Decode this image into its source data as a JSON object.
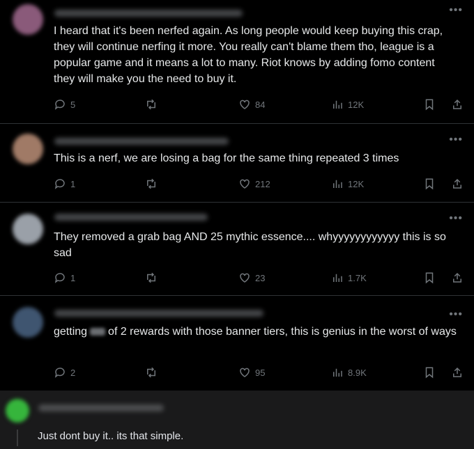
{
  "tweets": [
    {
      "text": "I heard that it's been nerfed again. As long people would keep buying this crap, they will continue nerfing it more. You really can't blame them tho, league is a popular game and it means a lot to many. Riot knows by adding fomo content they will make you the need to buy it.",
      "replies": "5",
      "likes": "84",
      "views": "12K"
    },
    {
      "text": "This is a nerf, we are losing a bag for the same thing repeated 3 times",
      "replies": "1",
      "likes": "212",
      "views": "12K"
    },
    {
      "text": "They removed a grab bag AND 25 mythic essence.... whyyyyyyyyyyyy this is so sad",
      "replies": "1",
      "likes": "23",
      "views": "1.7K"
    },
    {
      "text_before": "getting",
      "text_after": "of 2 rewards with those banner tiers, this is genius in the worst of ways",
      "replies": "2",
      "likes": "95",
      "views": "8.9K"
    }
  ],
  "reply_card": {
    "text": "Just dont buy it.. its that simple."
  },
  "icons": {
    "reply": "speech-bubble-icon",
    "retweet": "retweet-arrows-icon",
    "like": "heart-icon",
    "views": "bar-chart-icon",
    "bookmark": "bookmark-icon",
    "share": "share-upload-icon",
    "more": "ellipsis-icon"
  },
  "colors": {
    "background": "#000000",
    "text": "#e7e9ea",
    "muted": "#71767b",
    "divider": "#2f3336",
    "reply_card_bg": "#1a1a1b"
  }
}
